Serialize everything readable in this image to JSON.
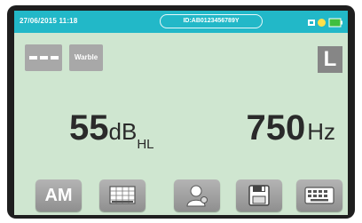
{
  "status_bar": {
    "datetime": "27/06/2015 11:18",
    "device_id": "ID:AB0123456789Y",
    "icons": [
      "usb-icon",
      "record-indicator-icon",
      "battery-icon"
    ]
  },
  "stimulus": {
    "pattern_icon": "dashed-pulse-icon",
    "type_label": "Warble"
  },
  "ear": {
    "label": "L"
  },
  "readout": {
    "level_value": "55",
    "level_unit": "dB",
    "level_sub": "HL",
    "frequency_value": "750",
    "frequency_unit": "Hz"
  },
  "toolbar": {
    "am_label": "AM",
    "buttons": [
      "am-button",
      "audiogram-grid-icon",
      "patient-icon",
      "save-icon",
      "keyboard-icon"
    ]
  },
  "colors": {
    "status_bar": "#22b8c8",
    "screen_bg": "#cfe6d0",
    "button_grey": "#a8a8a8",
    "ear_button": "#868686",
    "text": "#2a2a2a"
  }
}
